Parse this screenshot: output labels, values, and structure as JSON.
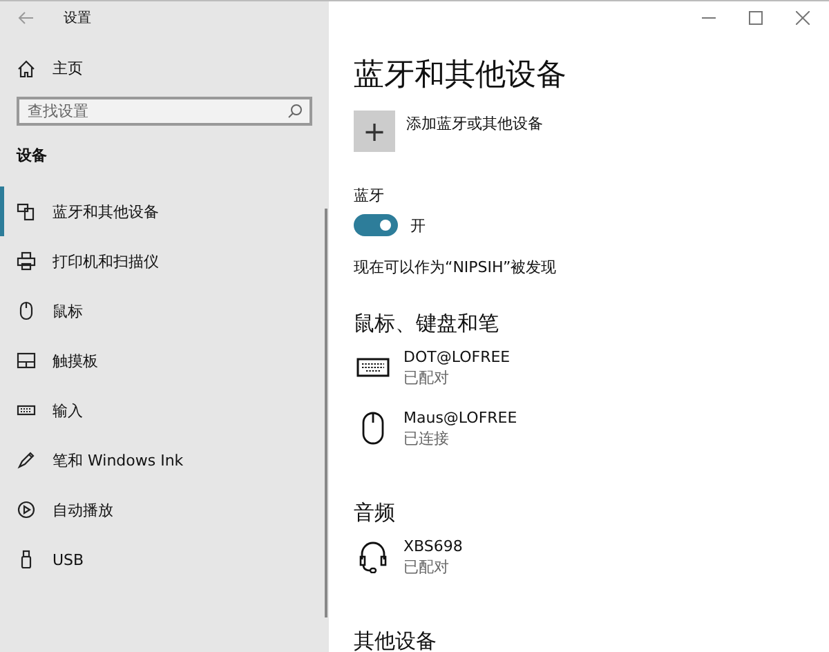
{
  "window": {
    "title": "设置"
  },
  "sidebar": {
    "home": "主页",
    "search": {
      "placeholder": "查找设置"
    },
    "section": "设备",
    "items": [
      {
        "label": "蓝牙和其他设备",
        "selected": true
      },
      {
        "label": "打印机和扫描仪",
        "selected": false
      },
      {
        "label": "鼠标",
        "selected": false
      },
      {
        "label": "触摸板",
        "selected": false
      },
      {
        "label": "输入",
        "selected": false
      },
      {
        "label": "笔和 Windows Ink",
        "selected": false
      },
      {
        "label": "自动播放",
        "selected": false
      },
      {
        "label": "USB",
        "selected": false
      }
    ]
  },
  "main": {
    "title": "蓝牙和其他设备",
    "add_button": {
      "icon": "+",
      "label": "添加蓝牙或其他设备"
    },
    "bluetooth": {
      "label": "蓝牙",
      "on": true,
      "state": "开"
    },
    "discoverable": "现在可以作为“NIPSIH”被发现",
    "sections": [
      {
        "title": "鼠标、键盘和笔",
        "devices": [
          {
            "kind": "keyboard",
            "name": "DOT@LOFREE",
            "status": "已配对"
          },
          {
            "kind": "mouse",
            "name": "Maus@LOFREE",
            "status": "已连接"
          }
        ]
      },
      {
        "title": "音频",
        "devices": [
          {
            "kind": "headset",
            "name": "XBS698",
            "status": "已配对"
          }
        ]
      },
      {
        "title": "其他设备"
      }
    ]
  }
}
